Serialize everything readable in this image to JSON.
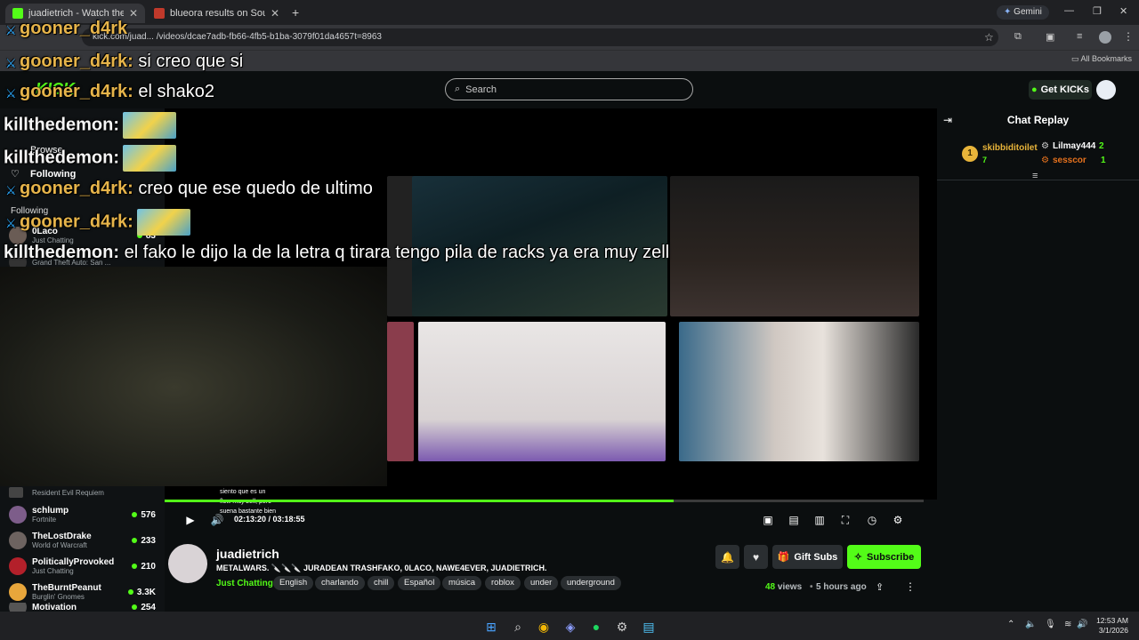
{
  "browser": {
    "tabs": [
      {
        "title": "juadietrich - Watch the VO",
        "active": true,
        "favicon_color": "#53fc18"
      },
      {
        "title": "blueora results on SoundCloud",
        "active": false,
        "favicon_color": "#c0392b"
      }
    ],
    "new_tab": "+",
    "gemini_label": "Gemini",
    "url": "kick.com/juad... /videos/dcae7adb-fb66-4fb5-b1ba-3079f01da4657t=8963",
    "bookmarks_label": "All Bookmarks"
  },
  "kick": {
    "logo": "KICK",
    "search_placeholder": "Search",
    "get_kicks": "Get KICKs"
  },
  "sidebar": {
    "browse": "Browse",
    "following": "Following",
    "following_section": "Following",
    "channels": [
      {
        "name": "0Laco",
        "game": "Just Chatting",
        "count": "83",
        "color": "#6a5c55"
      },
      {
        "name": "",
        "game": "Grand Theft Auto: San ...",
        "count": "",
        "color": "#333"
      },
      {
        "name": "",
        "game": "Resident Evil Requiem",
        "count": "",
        "color": "#444"
      },
      {
        "name": "schlump",
        "game": "Fortnite",
        "count": "576",
        "color": "#7d5d8a"
      },
      {
        "name": "TheLostDrake",
        "game": "World of Warcraft",
        "count": "233",
        "color": "#6d6360"
      },
      {
        "name": "PoliticallyProvoked",
        "game": "Just Chatting",
        "count": "210",
        "color": "#b3202a"
      },
      {
        "name": "TheBurntPeanut",
        "game": "Burglin' Gnomes",
        "count": "3.3K",
        "color": "#e8a63b"
      },
      {
        "name": "Motivation",
        "game": "",
        "count": "254",
        "color": "#555"
      }
    ]
  },
  "overlay_chat": [
    {
      "user": "gooner_d4rk",
      "msg": "",
      "kind": "g",
      "badge": true
    },
    {
      "user": "gooner_d4rk:",
      "msg": "si creo que si",
      "kind": "g",
      "badge": true
    },
    {
      "user": "gooner_d4rk:",
      "msg": "el shako2",
      "kind": "g",
      "badge": true
    },
    {
      "user": "killthedemon:",
      "msg": "",
      "kind": "k",
      "badge": false,
      "emote": true
    },
    {
      "user": "killthedemon:",
      "msg": "",
      "kind": "k",
      "badge": false,
      "emote": true
    },
    {
      "user": "gooner_d4rk:",
      "msg": "creo que ese quedo de ultimo",
      "kind": "g",
      "badge": true
    },
    {
      "user": "gooner_d4rk:",
      "msg": "",
      "kind": "g",
      "badge": true,
      "emote": true
    },
    {
      "user": "killthedemon:",
      "msg": "el fako le dijo la de la letra q tirara tengo pila de racks ya era muy zell",
      "kind": "k",
      "badge": false
    }
  ],
  "player": {
    "time": "02:13:20 / 03:18:55",
    "progress": 0.67,
    "subtitles": [
      "siento que es un",
      "flow muy zell, pero",
      "suena bastante bien"
    ]
  },
  "chat_replay": {
    "title": "Chat Replay",
    "left_rank": "1",
    "left_user": "skibbiditoilet",
    "left_count": "7",
    "right": [
      {
        "user": "Lilmay444",
        "count": "2",
        "color": "#ffffff"
      },
      {
        "user": "sesscor",
        "count": "1",
        "color": "#e6721e"
      }
    ]
  },
  "channel": {
    "name": "juadietrich",
    "title": "METALWARS. 🔪🔪🔪 JURADEAN TRASHFAKO, 0LACO, NAWE4EVER, JUADIETRICH.",
    "category": "Just Chatting",
    "tags": [
      "English",
      "charlando",
      "chill",
      "Español",
      "música",
      "roblox",
      "under",
      "underground"
    ],
    "gift_subs": "Gift Subs",
    "subscribe": "Subscribe",
    "views_count": "48",
    "views_label": "views",
    "ago": "5 hours ago"
  },
  "taskbar": {
    "time": "12:53 AM",
    "date": "3/1/2026"
  }
}
